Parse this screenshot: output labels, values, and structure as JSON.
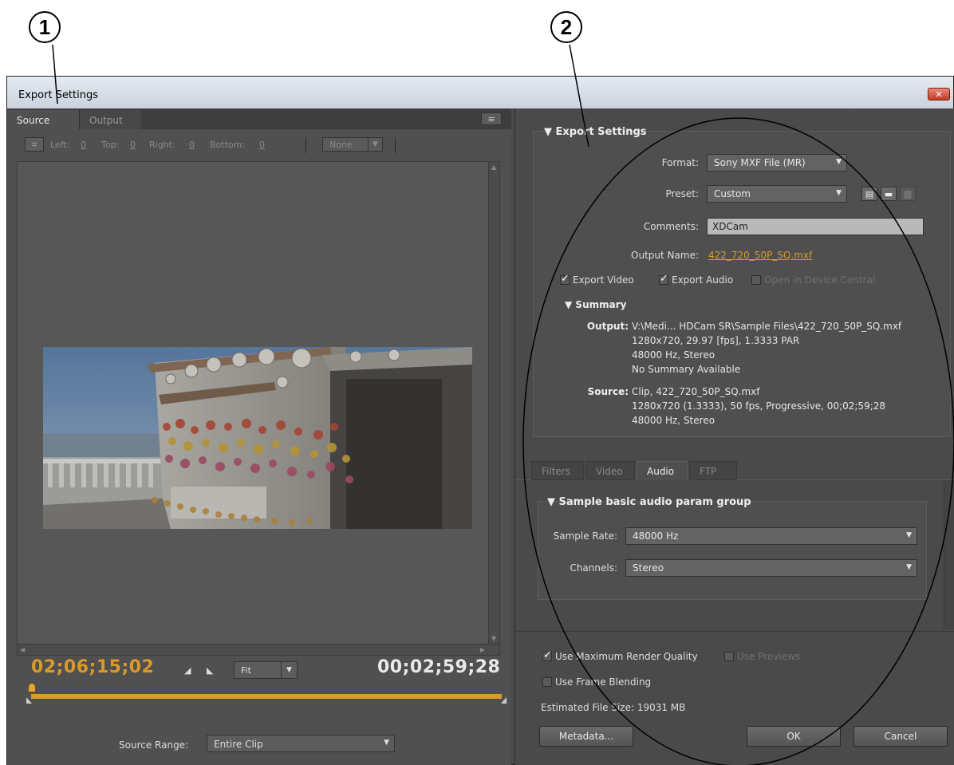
{
  "callouts": [
    "1",
    "2"
  ],
  "window": {
    "title": "Export Settings",
    "close_label": "✕"
  },
  "left": {
    "tabs": [
      "Source",
      "Output"
    ],
    "panel_menu_icon": "≡",
    "crop": {
      "left_label": "Left:",
      "left_value": "0",
      "top_label": "Top:",
      "top_value": "0",
      "right_label": "Right:",
      "right_value": "0",
      "bottom_label": "Bottom:",
      "bottom_value": "0",
      "aspect_value": "None"
    },
    "current_timecode": "02;06;15;02",
    "duration_timecode": "00;02;59;28",
    "fit_value": "Fit",
    "source_range_label": "Source Range:",
    "source_range_value": "Entire Clip"
  },
  "right": {
    "export_settings_title": "Export Settings",
    "format_label": "Format:",
    "format_value": "Sony MXF File (MR)",
    "preset_label": "Preset:",
    "preset_value": "Custom",
    "comments_label": "Comments:",
    "comments_value": "XDCam",
    "output_name_label": "Output Name:",
    "output_name_value": "422_720_50P_SQ.mxf",
    "export_video_label": "Export Video",
    "export_audio_label": "Export Audio",
    "open_device_label": "Open in Device Central",
    "summary_title": "Summary",
    "output_key": "Output:",
    "output_lines": [
      "V:\\Medi... HDCam SR\\Sample Files\\422_720_50P_SQ.mxf",
      "1280x720, 29.97 [fps], 1.3333 PAR",
      "48000 Hz, Stereo",
      "No Summary Available"
    ],
    "source_key": "Source:",
    "source_lines": [
      "Clip, 422_720_50P_SQ.mxf",
      "1280x720 (1.3333), 50 fps, Progressive, 00;02;59;28",
      "48000 Hz, Stereo"
    ],
    "tabs": [
      "Filters",
      "Video",
      "Audio",
      "FTP"
    ],
    "audio_group_title": "Sample basic audio param group",
    "sample_rate_label": "Sample Rate:",
    "sample_rate_value": "48000 Hz",
    "channels_label": "Channels:",
    "channels_value": "Stereo",
    "max_render_label": "Use Maximum Render Quality",
    "use_previews_label": "Use Previews",
    "frame_blending_label": "Use Frame Blending",
    "file_size_text": "Estimated File Size:  19031 MB",
    "metadata_button": "Metadata...",
    "ok_button": "OK",
    "cancel_button": "Cancel"
  },
  "colors": {
    "timecode_accent": "#d89a2a",
    "panel_bg": "#4a4a4a",
    "titlebar": "#c9d2de"
  }
}
